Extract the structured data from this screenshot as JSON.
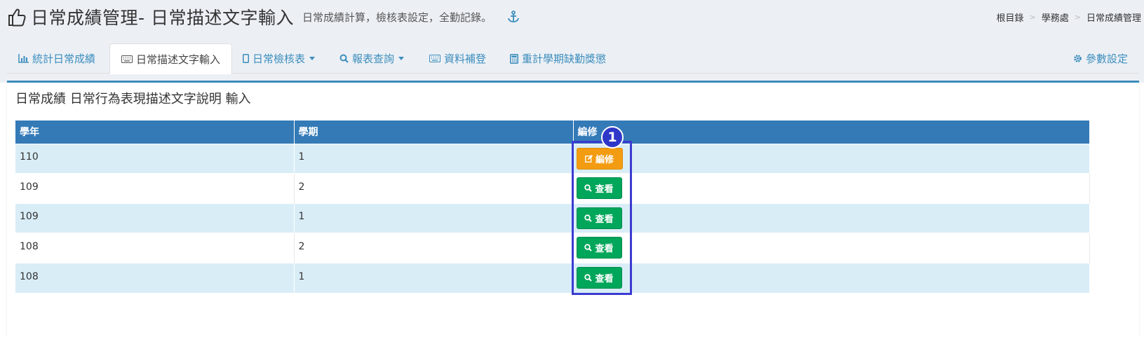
{
  "header": {
    "title": "日常成績管理- 日常描述文字輸入",
    "subtitle": "日常成績計算，檢核表設定，全勤記錄。"
  },
  "breadcrumb": [
    "根目錄",
    "學務處",
    "日常成績管理"
  ],
  "tabs": [
    {
      "label": "統計日常成績",
      "icon": "bar-chart-icon",
      "active": false
    },
    {
      "label": "日常描述文字輸入",
      "icon": "keyboard-icon",
      "active": true
    },
    {
      "label": "日常檢核表",
      "icon": "tablet-icon",
      "dropdown": true
    },
    {
      "label": "報表查詢",
      "icon": "search-icon",
      "dropdown": true
    },
    {
      "label": "資料補登",
      "icon": "keyboard-icon"
    },
    {
      "label": "重計學期缺勤獎懲",
      "icon": "calculator-icon"
    },
    {
      "label": "參數設定",
      "icon": "gear-icon"
    }
  ],
  "panel": {
    "title": "日常成績 日常行為表現描述文字說明 輸入"
  },
  "table": {
    "headers": [
      "學年",
      "學期",
      "編修"
    ],
    "rows": [
      {
        "year": "110",
        "semester": "1",
        "action": "編修"
      },
      {
        "year": "109",
        "semester": "2",
        "action": "查看"
      },
      {
        "year": "109",
        "semester": "1",
        "action": "查看"
      },
      {
        "year": "108",
        "semester": "2",
        "action": "查看"
      },
      {
        "year": "108",
        "semester": "1",
        "action": "查看"
      }
    ]
  },
  "annotation": {
    "step": "1"
  },
  "colors": {
    "primary": "#337ab7",
    "link": "#3c8dbc",
    "warning": "#f39c12",
    "success": "#00a65a",
    "row_stripe": "#d9edf7",
    "annotation": "#3b3bd1"
  }
}
